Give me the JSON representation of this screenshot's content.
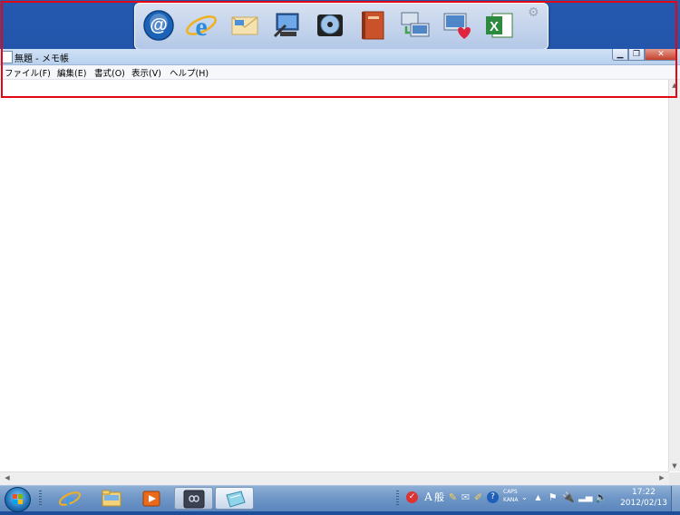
{
  "launcher": {
    "items": [
      {
        "name": "mail-at-icon"
      },
      {
        "name": "internet-explorer-icon"
      },
      {
        "name": "envelope-icon"
      },
      {
        "name": "computer-tool-icon"
      },
      {
        "name": "disc-player-icon"
      },
      {
        "name": "manual-book-icon"
      },
      {
        "name": "network-computer-icon"
      },
      {
        "name": "computer-heart-icon"
      },
      {
        "name": "excel-icon"
      }
    ],
    "settings_glyph": "⚙"
  },
  "notepad": {
    "title": "無題 - メモ帳",
    "menu": [
      "ファイル(F)",
      "編集(E)",
      "書式(O)",
      "表示(V)",
      "ヘルプ(H)"
    ],
    "content": ""
  },
  "taskbar": {
    "ime": {
      "mode_glyph": "A",
      "conversion": "般",
      "caps": "CAPS",
      "kana": "KANA",
      "help": "?"
    },
    "clock": {
      "time": "17:22",
      "date": "2012/02/13"
    }
  },
  "colors": {
    "highlight": "#e30613",
    "taskbar": "#6f97c7",
    "titlebar": "#c3d7f0"
  }
}
